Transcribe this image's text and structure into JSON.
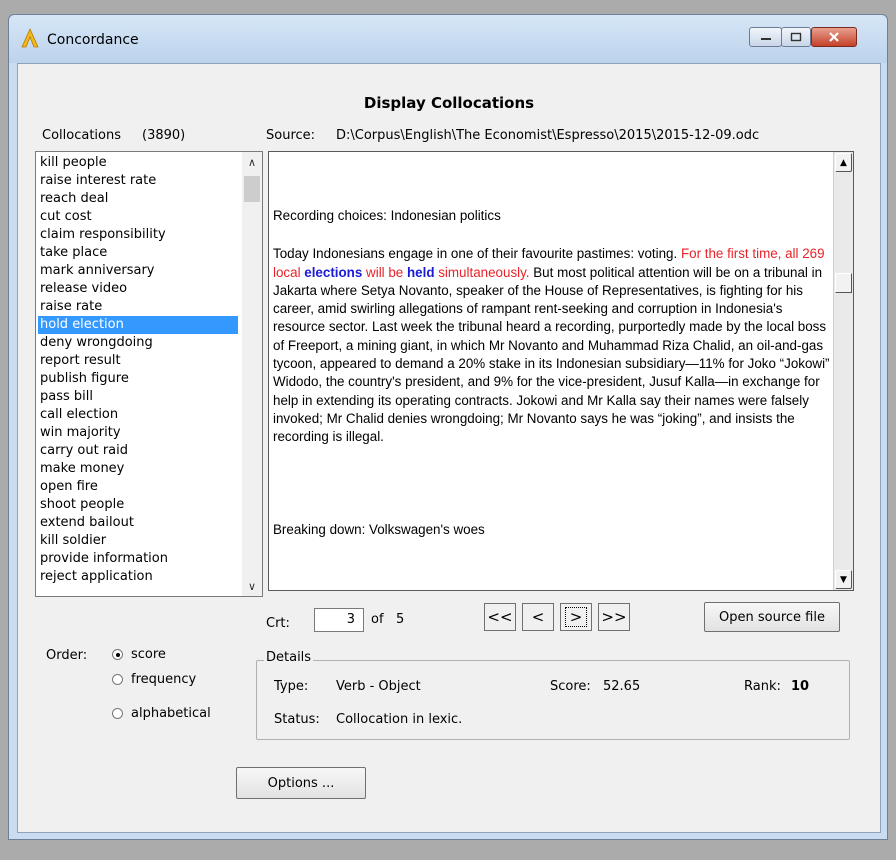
{
  "window": {
    "title": "Concordance",
    "controls": {
      "minimize": "minimize",
      "maximize": "maximize",
      "close": "close"
    }
  },
  "heading": "Display Collocations",
  "collocations": {
    "label": "Collocations",
    "count": "(3890)",
    "items": [
      "kill people",
      "raise interest rate",
      "reach deal",
      "cut cost",
      "claim responsibility",
      "take place",
      "mark anniversary",
      "release video",
      "raise rate",
      "hold election",
      "deny wrongdoing",
      "report result",
      "publish figure",
      "pass bill",
      "call election",
      "win majority",
      "carry out raid",
      "make money",
      "open fire",
      "shoot people",
      "extend bailout",
      "kill soldier",
      "provide information",
      "reject application"
    ],
    "selected": "hold election"
  },
  "source": {
    "label": "Source:",
    "path": "D:\\Corpus\\English\\The Economist\\Espresso\\2015\\2015-12-09.odc"
  },
  "text": {
    "heading1": "Recording choices: Indonesian politics",
    "para_start": "Today Indonesians engage in one of their favourite pastimes: voting. ",
    "hl_1": "For the first time, all 269 local ",
    "hl_kw1": "elections",
    "hl_2": " will be ",
    "hl_kw2": "held",
    "hl_3": " simultaneously.",
    "para_rest": " But most political attention will be on a tribunal in Jakarta where Setya Novanto, speaker of the House of Representatives, is fighting for his career, amid swirling allegations of rampant rent-seeking and corruption in Indonesia's resource sector. Last week the tribunal heard a recording, purportedly made by the local boss of Freeport, a mining giant, in which Mr Novanto and Muhammad Riza Chalid, an oil-and-gas tycoon, appeared to demand a 20% stake in its Indonesian subsidiary—11% for Joko “Jokowi” Widodo, the country's president, and 9% for the vice-president, Jusuf Kalla—in exchange for help in extending its operating contracts. Jokowi and Mr Kalla say their names were falsely invoked; Mr Chalid denies wrongdoing; Mr Novanto says he was “joking”, and insists the recording is illegal.",
    "heading2": "Breaking down: Volkswagen's woes"
  },
  "navigation": {
    "crt_label": "Crt:",
    "crt_value": "3",
    "of_label": "of",
    "total": "5",
    "first": "<<",
    "prev": "<",
    "next": ">",
    "last": ">>",
    "open_source": "Open source file"
  },
  "order": {
    "label": "Order:",
    "options": [
      "score",
      "frequency",
      "alphabetical"
    ],
    "selected": "score"
  },
  "details": {
    "legend": "Details",
    "type_label": "Type:",
    "type_value": "Verb - Object",
    "score_label": "Score:",
    "score_value": "52.65",
    "rank_label": "Rank:",
    "rank_value": "10",
    "status_label": "Status:",
    "status_value": "Collocation in lexic."
  },
  "options_button": "Options ...",
  "colors": {
    "selection": "#3399ff",
    "collocation_highlight": "#e8232a",
    "keyword": "#1b1bd6"
  }
}
